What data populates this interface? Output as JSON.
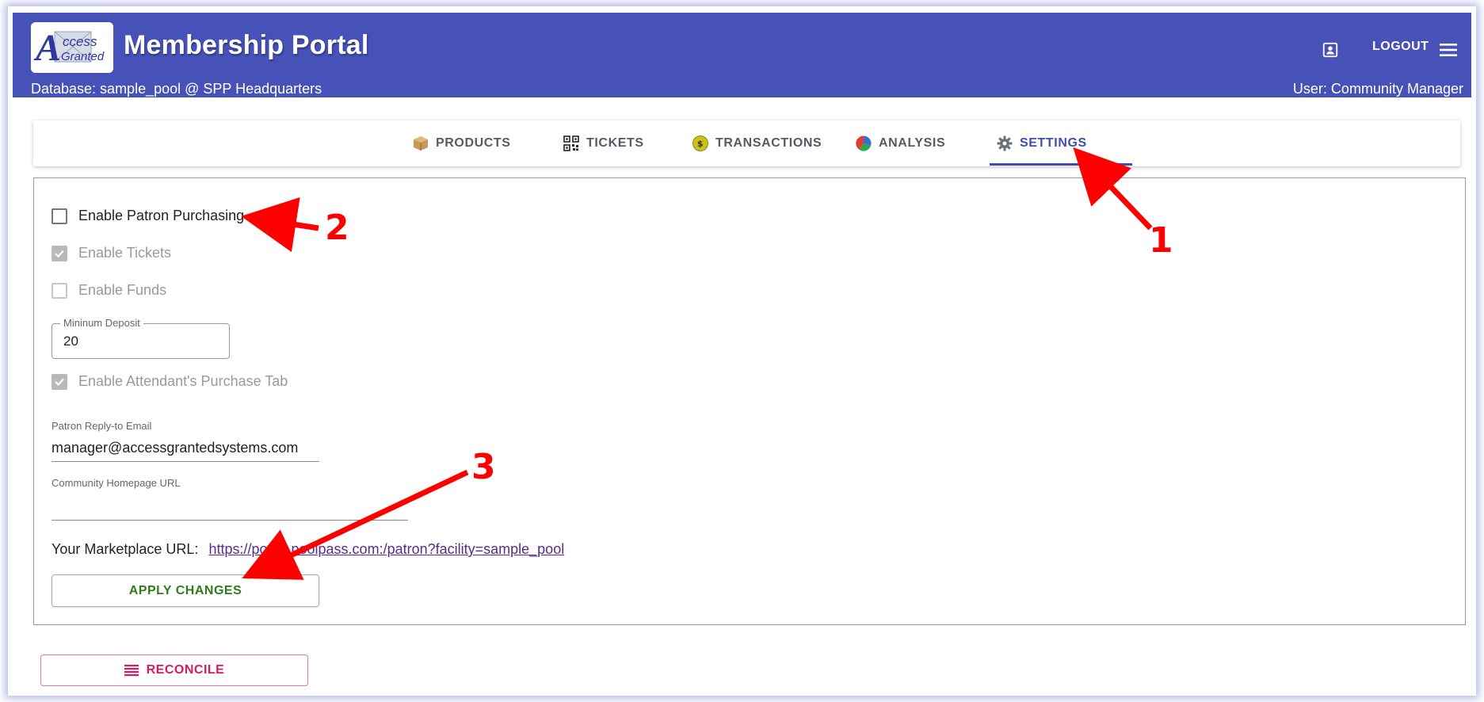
{
  "header": {
    "logo_text_a": "A",
    "logo_text_line1": "ccess",
    "logo_text_line2": "Granted",
    "title": "Membership Portal",
    "database": "Database: sample_pool @ SPP Headquarters",
    "user": "User: Community Manager",
    "logout_label": "LOGOUT",
    "icons": [
      "account-box-icon",
      "menu-icon"
    ]
  },
  "tabs": [
    {
      "label": "PRODUCTS",
      "icon": "package-icon"
    },
    {
      "label": "TICKETS",
      "icon": "qr-code-icon"
    },
    {
      "label": "TRANSACTIONS",
      "icon": "coin-icon",
      "icon_text": "$"
    },
    {
      "label": "ANALYSIS",
      "icon": "pie-chart-icon"
    },
    {
      "label": "SETTINGS",
      "icon": "gear-icon",
      "active": true
    }
  ],
  "settings": {
    "enable_patron_purchasing": {
      "label": "Enable Patron Purchasing",
      "checked": false,
      "disabled": false
    },
    "enable_tickets": {
      "label": "Enable Tickets",
      "checked": true,
      "disabled": true
    },
    "enable_funds": {
      "label": "Enable Funds",
      "checked": false,
      "disabled": true
    },
    "minimum_deposit": {
      "label": "Mininum Deposit",
      "value": "20"
    },
    "enable_attendant_tab": {
      "label": "Enable Attendant's Purchase Tab",
      "checked": true,
      "disabled": true
    },
    "reply_to_email": {
      "label": "Patron Reply-to Email",
      "value": "manager@accessgrantedsystems.com"
    },
    "homepage_url": {
      "label": "Community Homepage URL",
      "value": ""
    },
    "marketplace_url_label": "Your Marketplace URL:",
    "marketplace_url": "https://portal.poolpass.com:/patron?facility=sample_pool",
    "apply_label": "APPLY CHANGES"
  },
  "reconcile_label": "RECONCILE",
  "annotations": [
    "1",
    "2",
    "3"
  ],
  "colors": {
    "header": "#4652b8",
    "active_tab": "#3f4cb0",
    "apply_text": "#2e7d1a",
    "reconcile": "#d81b60",
    "annotation": "#ff0000"
  }
}
